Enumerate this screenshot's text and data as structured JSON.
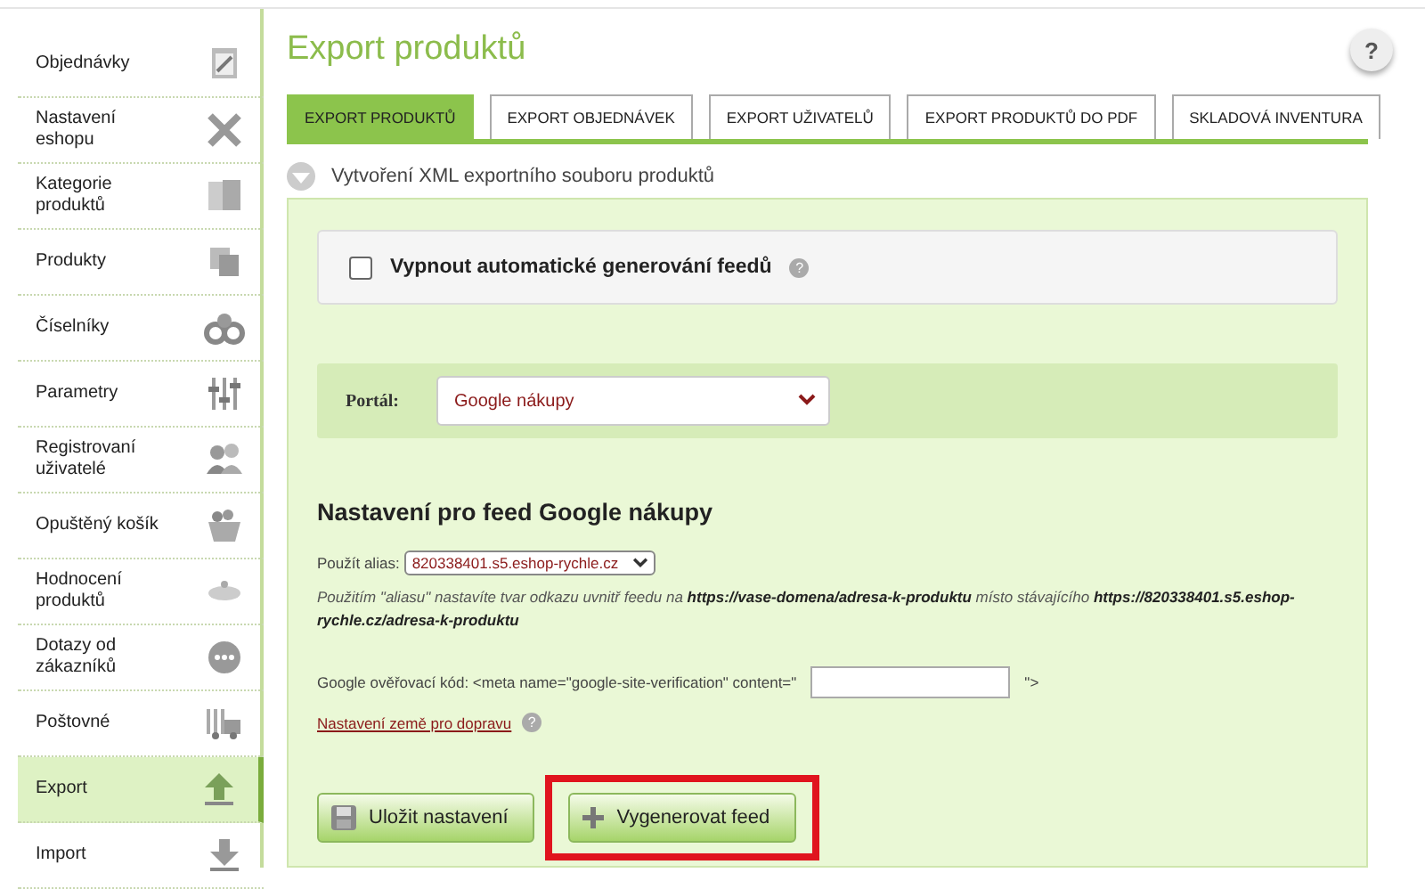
{
  "sidebar": {
    "items": [
      {
        "label": "Objednávky",
        "selected": false
      },
      {
        "label": "Nastavení eshopu",
        "selected": false
      },
      {
        "label": "Kategorie produktů",
        "selected": false
      },
      {
        "label": "Produkty",
        "selected": false
      },
      {
        "label": "Číselníky",
        "selected": false
      },
      {
        "label": "Parametry",
        "selected": false
      },
      {
        "label": "Registrovaní uživatelé",
        "selected": false
      },
      {
        "label": "Opuštěný košík",
        "selected": false
      },
      {
        "label": "Hodnocení produktů",
        "selected": false
      },
      {
        "label": "Dotazy od zákazníků",
        "selected": false
      },
      {
        "label": "Poštovné",
        "selected": false
      },
      {
        "label": "Export",
        "selected": true
      },
      {
        "label": "Import",
        "selected": false
      }
    ]
  },
  "page": {
    "title": "Export produktů",
    "help": "?"
  },
  "tabs": [
    {
      "label": "EXPORT PRODUKTŮ",
      "selected": true
    },
    {
      "label": "EXPORT OBJEDNÁVEK",
      "selected": false
    },
    {
      "label": "EXPORT UŽIVATELŮ",
      "selected": false
    },
    {
      "label": "EXPORT PRODUKTŮ DO PDF",
      "selected": false
    },
    {
      "label": "SKLADOVÁ INVENTURA",
      "selected": false
    }
  ],
  "section": {
    "title": "Vytvoření XML exportního souboru produktů"
  },
  "auto_feed": {
    "label": "Vypnout automatické generování feedů",
    "checked": false,
    "help": "?"
  },
  "portal": {
    "label": "Portál:",
    "value": "Google nákupy"
  },
  "feed_settings": {
    "heading": "Nastavení pro feed Google nákupy",
    "alias_label": "Použít alias:",
    "alias_value": "820338401.s5.eshop-rychle.cz",
    "note": "Použitím \"aliasu\" nastavíte tvar odkazu uvnitř feedu na **https://vase-domena/adresa-k-produktu** místo stávajícího **https://820338401.s5.eshop-rychle.cz/adresa-k-produktu**",
    "verification_label": "Google ověřovací kód: <meta name=\"google-site-verification\" content=\"",
    "verification_suffix": "\">",
    "shipping_link": "Nastavení země pro dopravu",
    "shipping_help": "?"
  },
  "buttons": [
    {
      "label": "Uložit nastavení",
      "kind": "save",
      "highlighted": false
    },
    {
      "label": "Vygenerovat feed",
      "kind": "generate",
      "highlighted": true
    }
  ]
}
